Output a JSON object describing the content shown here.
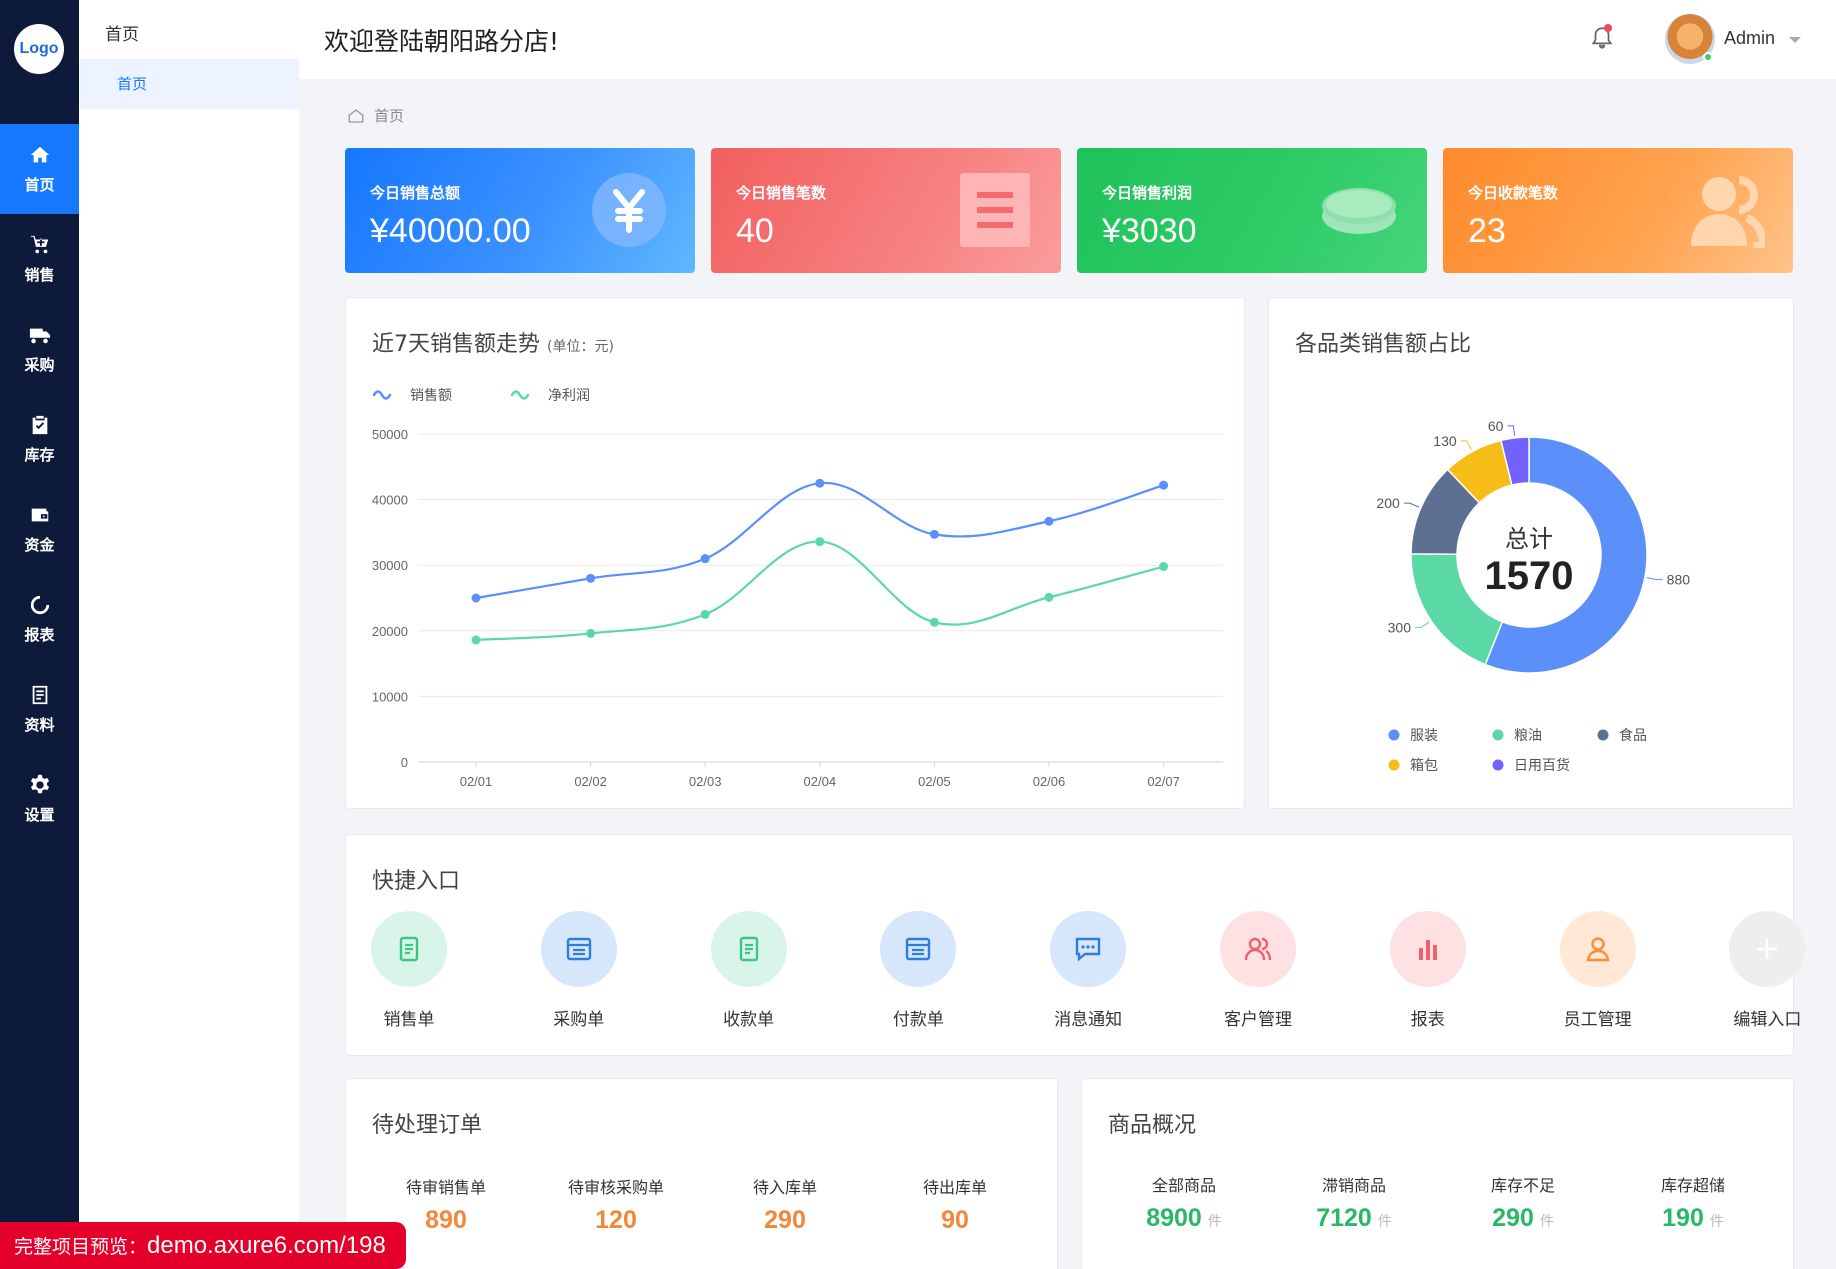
{
  "app": {
    "logo": "Logo"
  },
  "nav": [
    {
      "label": "首页",
      "icon": "home-icon",
      "active": true
    },
    {
      "label": "销售",
      "icon": "cart-icon"
    },
    {
      "label": "采购",
      "icon": "truck-icon"
    },
    {
      "label": "库存",
      "icon": "clipboard-check-icon"
    },
    {
      "label": "资金",
      "icon": "wallet-icon"
    },
    {
      "label": "报表",
      "icon": "ring-chart-icon"
    },
    {
      "label": "资料",
      "icon": "document-icon"
    },
    {
      "label": "设置",
      "icon": "gear-icon"
    }
  ],
  "subnav": {
    "title": "首页",
    "items": [
      "首页"
    ]
  },
  "header": {
    "welcome": "欢迎登陆朝阳路分店!",
    "user": "Admin"
  },
  "breadcrumb": "首页",
  "stats": [
    {
      "label": "今日销售总额",
      "value": "¥40000.00",
      "icon": "yuan-icon",
      "color": "#1677ff"
    },
    {
      "label": "今日销售笔数",
      "value": "40",
      "icon": "list-icon",
      "color": "#f46b6b"
    },
    {
      "label": "今日销售利润",
      "value": "¥3030",
      "icon": "coins-icon",
      "color": "#2dc86a"
    },
    {
      "label": "今日收款笔数",
      "value": "23",
      "icon": "users-icon",
      "color": "#ff9a3c"
    }
  ],
  "trend": {
    "title": "近7天销售额走势",
    "unit": "(单位：元)",
    "chart_data": {
      "type": "line",
      "x": [
        "02/01",
        "02/02",
        "02/03",
        "02/04",
        "02/05",
        "02/06",
        "02/07"
      ],
      "series": [
        {
          "name": "销售额",
          "color": "#5b8ff9",
          "values": [
            25000,
            28000,
            31000,
            42500,
            34700,
            36700,
            42200
          ]
        },
        {
          "name": "净利润",
          "color": "#5ad8a6",
          "values": [
            18600,
            19600,
            22500,
            33600,
            21300,
            25100,
            29800
          ]
        }
      ],
      "ylim": [
        0,
        50000
      ],
      "yticks": [
        0,
        10000,
        20000,
        30000,
        40000,
        50000
      ],
      "grid": true,
      "legend": "top-left"
    }
  },
  "category": {
    "title": "各品类销售额占比",
    "total_label": "总计",
    "total_value": "1570",
    "chart_data": {
      "type": "pie",
      "categories": [
        "服装",
        "粮油",
        "食品",
        "箱包",
        "日用百货"
      ],
      "values": [
        880,
        300,
        200,
        130,
        60
      ],
      "colors": [
        "#5b8ff9",
        "#5ad8a6",
        "#5d7092",
        "#f6bd16",
        "#7262fd"
      ],
      "legend": "bottom"
    }
  },
  "quick": {
    "title": "快捷入口",
    "items": [
      {
        "label": "销售单",
        "icon": "document-icon",
        "bg": "#d9f5ea",
        "fg": "#3cc585"
      },
      {
        "label": "采购单",
        "icon": "form-icon",
        "bg": "#d6e7fb",
        "fg": "#2e7de0"
      },
      {
        "label": "收款单",
        "icon": "document-icon",
        "bg": "#d9f5ea",
        "fg": "#3cc585"
      },
      {
        "label": "付款单",
        "icon": "form-icon",
        "bg": "#d6e7fb",
        "fg": "#2e7de0"
      },
      {
        "label": "消息通知",
        "icon": "message-icon",
        "bg": "#d6e7fb",
        "fg": "#2e7de0"
      },
      {
        "label": "客户管理",
        "icon": "users-icon",
        "bg": "#fde1e3",
        "fg": "#f0616d"
      },
      {
        "label": "报表",
        "icon": "bar-chart-icon",
        "bg": "#fde1e3",
        "fg": "#f0616d"
      },
      {
        "label": "员工管理",
        "icon": "user-icon",
        "bg": "#ffe9d6",
        "fg": "#ff8b36"
      },
      {
        "label": "编辑入口",
        "icon": "plus-icon",
        "bg": "#eeeeee",
        "fg": "#ffffff"
      }
    ]
  },
  "pending": {
    "title": "待处理订单",
    "items": [
      {
        "label": "待审销售单",
        "value": "890"
      },
      {
        "label": "待审核采购单",
        "value": "120"
      },
      {
        "label": "待入库单",
        "value": "290"
      },
      {
        "label": "待出库单",
        "value": "90"
      }
    ]
  },
  "goods": {
    "title": "商品概况",
    "unit": "件",
    "items": [
      {
        "label": "全部商品",
        "value": "8900"
      },
      {
        "label": "滞销商品",
        "value": "7120"
      },
      {
        "label": "库存不足",
        "value": "290"
      },
      {
        "label": "库存超储",
        "value": "190"
      }
    ]
  },
  "banner": {
    "prefix": "完整项目预览：",
    "url": "demo.axure6.com/198"
  }
}
